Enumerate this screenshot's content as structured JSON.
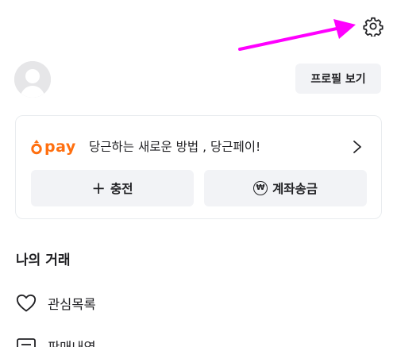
{
  "header": {
    "settings_icon": "gear-icon"
  },
  "profile": {
    "avatar_icon": "user-avatar-icon",
    "view_profile_label": "프로필 보기"
  },
  "pay": {
    "brand": "pay",
    "slogan": "당근하는 새로운 방법 , 당근페이!",
    "charge_label": "충전",
    "transfer_label": "계좌송금",
    "colors": {
      "brand_orange": "#ff6f0f"
    }
  },
  "my_trades": {
    "title": "나의 거래",
    "items": [
      {
        "label": "관심목록",
        "icon": "heart-icon"
      },
      {
        "label": "판매내역",
        "icon": "receipt-icon"
      }
    ]
  },
  "annotation": {
    "arrow_color": "#ff00ff"
  }
}
